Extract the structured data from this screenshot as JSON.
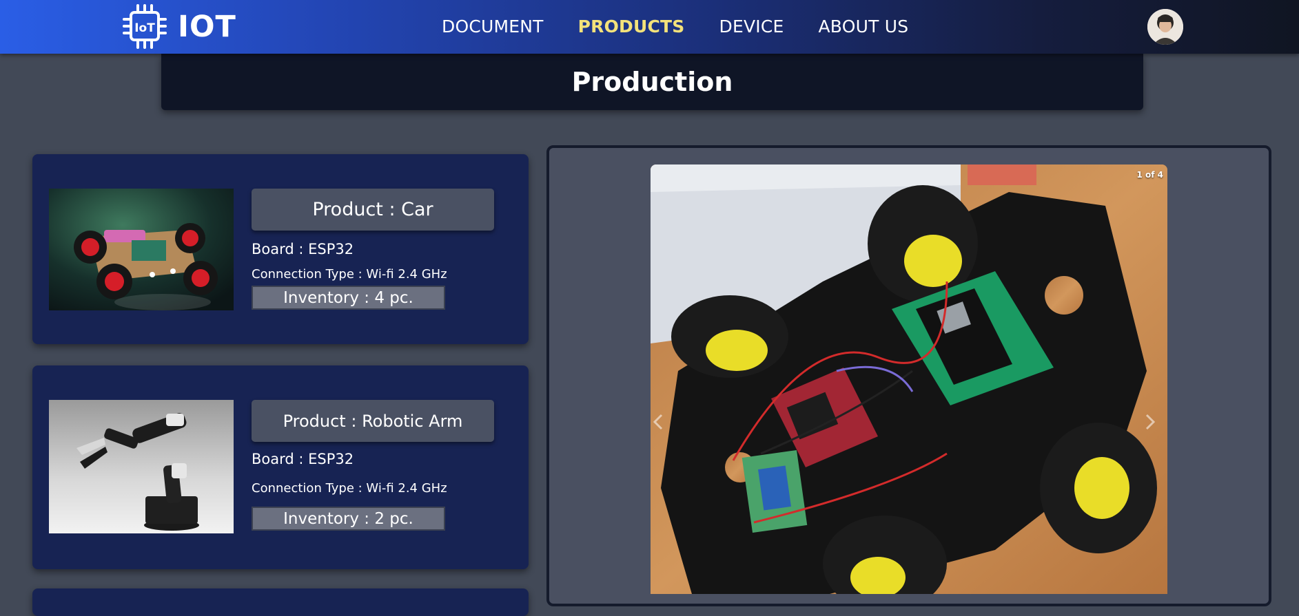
{
  "nav": {
    "brand": "IOT",
    "links": [
      "DOCUMENT",
      "PRODUCTS",
      "DEVICE",
      "ABOUT US"
    ],
    "active_link": "PRODUCTS",
    "active_color": "#f4e27a"
  },
  "banner": {
    "title": "Production"
  },
  "products": [
    {
      "name": "Product : Car",
      "board": "Board : ESP32",
      "connection": "Connection Type : Wi-fi 2.4 GHz",
      "inventory": "Inventory : 4 pc."
    },
    {
      "name": "Product : Robotic Arm",
      "board": "Board : ESP32",
      "connection": "Connection Type : Wi-fi 2.4 GHz",
      "inventory": "Inventory : 2 pc."
    }
  ],
  "carousel": {
    "counter": "1 of 4",
    "current_slide": 1,
    "total_slides": 4
  },
  "colors": {
    "nav_gradient_start": "#2a5ee6",
    "nav_gradient_end": "#101522",
    "background": "#424957",
    "card": "#172353",
    "banner": "#0f1526"
  }
}
